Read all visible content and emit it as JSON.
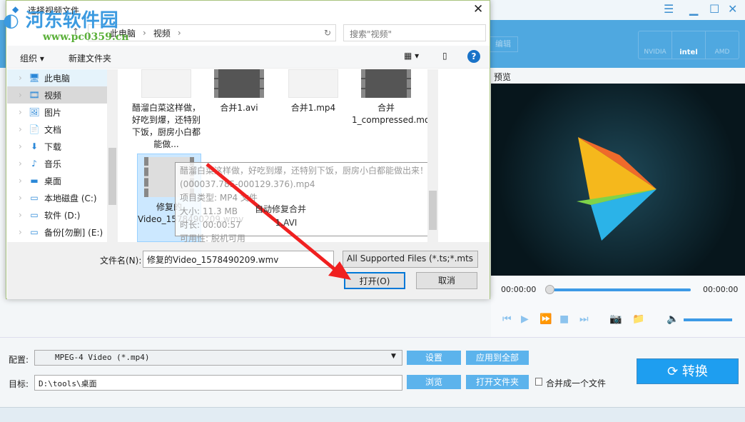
{
  "app": {
    "edit_label": "编辑",
    "gpu": [
      "NVIDIA",
      "intel",
      "AMD"
    ],
    "preview_label": "预览",
    "time_start": "00:00:00",
    "time_end": "00:00:00",
    "volume_percent": 100,
    "seek_percent": 0,
    "profile_label": "配置:",
    "profile_value": "MPEG-4 Video (*.mp4)",
    "settings_btn": "设置",
    "apply_all_btn": "应用到全部",
    "target_label": "目标:",
    "target_value": "D:\\tools\\桌面",
    "browse_btn": "浏览",
    "open_folder_btn": "打开文件夹",
    "merge_label": "合并成一个文件",
    "convert_btn": "转换",
    "accent": "#4fa8e0"
  },
  "dialog": {
    "title": "选择视频文件",
    "breadcrumb": [
      "此电脑",
      "视频"
    ],
    "search_placeholder": "搜索\"视频\"",
    "organize": "组织 ▾",
    "new_folder": "新建文件夹",
    "nav": [
      {
        "label": "此电脑",
        "icon": "computer-icon"
      },
      {
        "label": "视频",
        "icon": "video-icon"
      },
      {
        "label": "图片",
        "icon": "picture-icon"
      },
      {
        "label": "文档",
        "icon": "document-icon"
      },
      {
        "label": "下载",
        "icon": "download-icon"
      },
      {
        "label": "音乐",
        "icon": "music-icon"
      },
      {
        "label": "桌面",
        "icon": "desktop-icon"
      },
      {
        "label": "本地磁盘 (C:)",
        "icon": "drive-icon"
      },
      {
        "label": "软件 (D:)",
        "icon": "drive-icon"
      },
      {
        "label": "备份[勿删] (E:)",
        "icon": "drive-icon"
      }
    ],
    "files": [
      "醋溜白菜这样做，好吃到爆，还特别下饭，厨房小白都能做...",
      "合并1.avi",
      "合并1.mp4",
      "合并1_compressed.mov",
      "修复的Video_1578490209.wmv",
      "自动修复合并",
      "1.AVI"
    ],
    "tooltip": [
      "醋溜白菜这样做，好吃到爆，还特别下饭，厨房小白都能做出来！(000037.785-000129.376).mp4",
      "项目类型: MP4 文件",
      "大小: 11.3 MB",
      "时长: 00:00:57",
      "可用性: 脱机可用"
    ],
    "filename_label": "文件名(N):",
    "filename_value": "修复的Video_1578490209.wmv",
    "filetype_value": "All Supported Files (*.ts;*.mts",
    "open_btn": "打开(O)",
    "cancel_btn": "取消"
  },
  "watermark": {
    "text": "河东软件园",
    "url": "www.pc0359.cn"
  }
}
